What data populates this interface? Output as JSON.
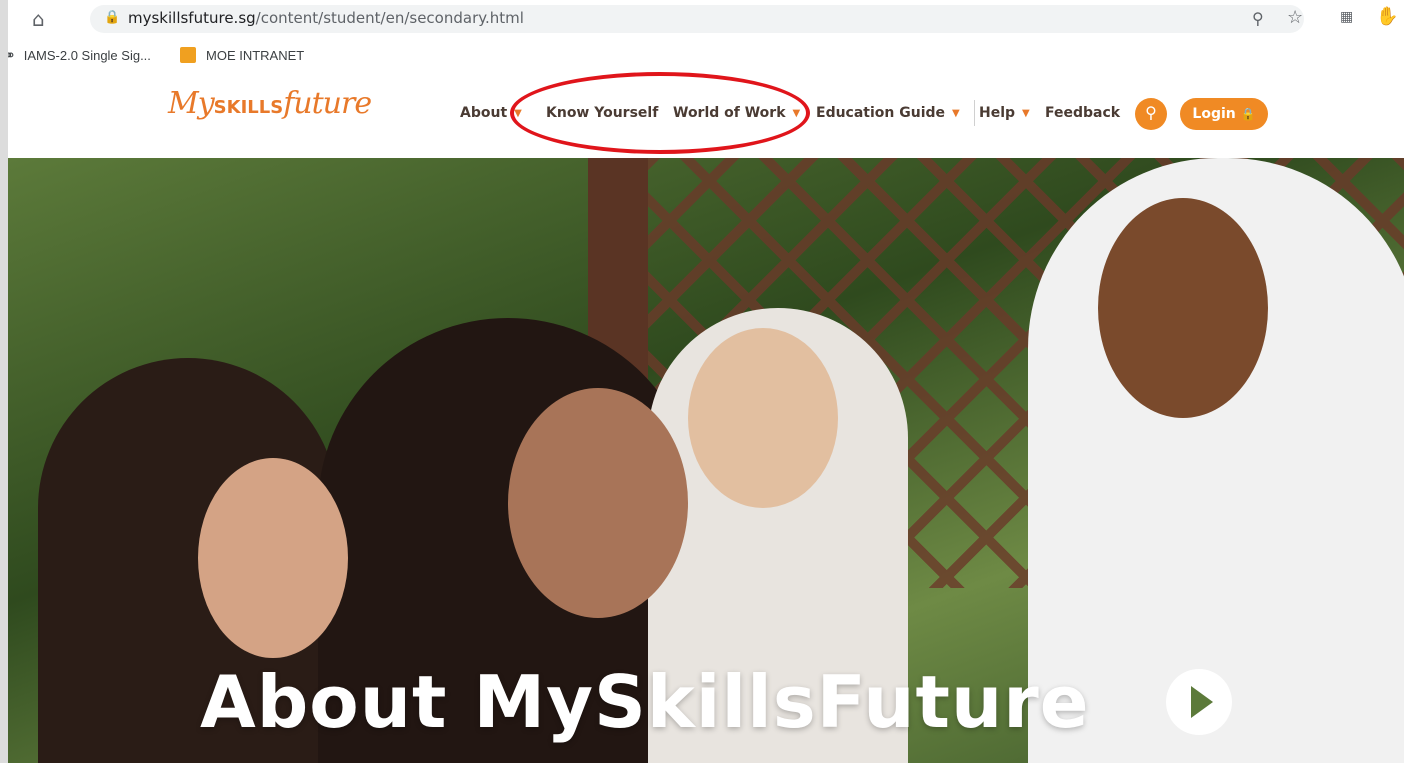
{
  "browser": {
    "url_host": "myskillsfuture.sg",
    "url_path": "/content/student/en/secondary.html",
    "bookmarks": [
      {
        "label": "IAMS-2.0 Single Sig...",
        "icon": "globe-icon"
      },
      {
        "label": "MOE INTRANET",
        "icon": "bookmark-favicon"
      }
    ]
  },
  "site": {
    "logo_my": "My",
    "logo_skills": "SKILLS",
    "logo_future": "future",
    "nav": [
      {
        "label": "About",
        "dropdown": true
      },
      {
        "label": "Know Yourself",
        "dropdown": false
      },
      {
        "label": "World of Work",
        "dropdown": true
      },
      {
        "label": "Education Guide",
        "dropdown": true
      },
      {
        "label": "Help",
        "dropdown": true
      },
      {
        "label": "Feedback",
        "dropdown": false
      }
    ],
    "login_label": "Login",
    "accent_color": "#f08a24"
  },
  "hero": {
    "title": "About MySkillsFuture"
  },
  "annotation": {
    "color": "#e0151b"
  }
}
